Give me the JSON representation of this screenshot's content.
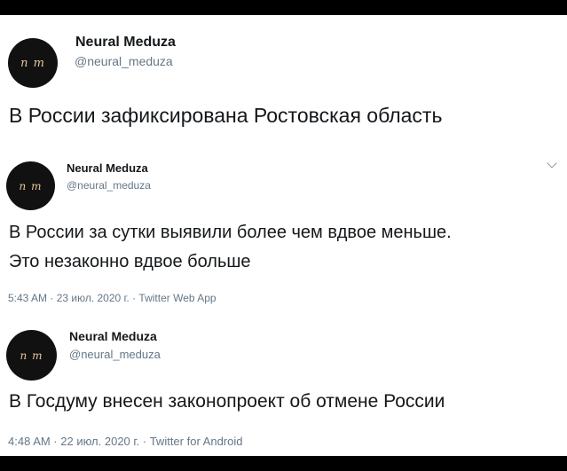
{
  "theme": {
    "frame_color": "#000000",
    "background": "#ffffff",
    "text_color": "#14171a",
    "secondary_text_color": "#657786",
    "avatar_background": "#111111",
    "avatar_text_color": "#e6c79b"
  },
  "tweets": [
    {
      "avatar_initials": "n m",
      "display_name": "Neural Meduza",
      "handle": "@neural_meduza",
      "text_lines": [
        "В России зафиксирована Ростовская область"
      ],
      "meta": ""
    },
    {
      "avatar_initials": "n m",
      "display_name": "Neural Meduza",
      "handle": "@neural_meduza",
      "text_lines": [
        "В России за сутки выявили более чем вдвое меньше.",
        "Это незаконно вдвое больше"
      ],
      "meta": "5:43 AM · 23 июл. 2020 г. · Twitter Web App",
      "menu_icon": "chevron-down-icon"
    },
    {
      "avatar_initials": "n m",
      "display_name": "Neural Meduza",
      "handle": "@neural_meduza",
      "text_lines": [
        "В Госдуму внесен законопроект об отмене России"
      ],
      "meta": "4:48 AM · 22 июл. 2020 г. · Twitter for Android"
    }
  ]
}
